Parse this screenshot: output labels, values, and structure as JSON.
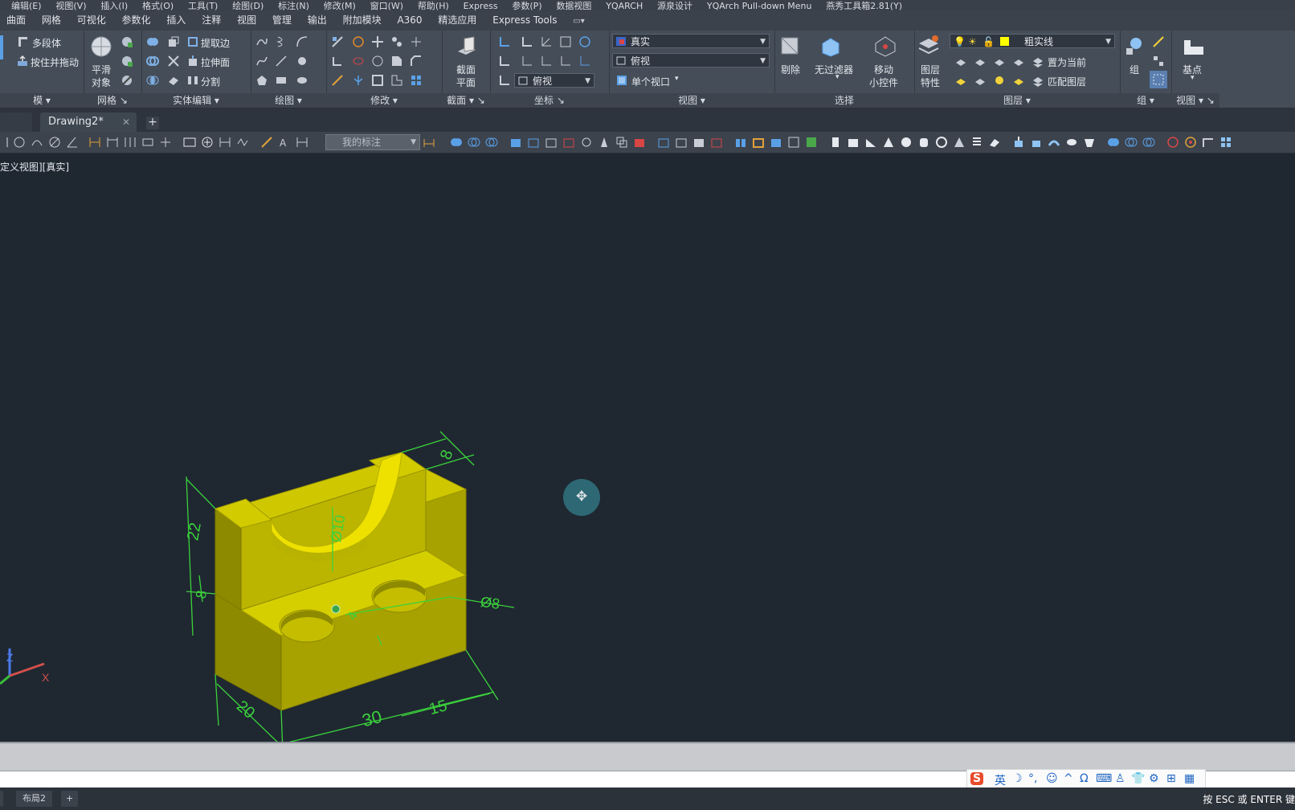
{
  "menu": [
    "编辑(E)",
    "视图(V)",
    "插入(I)",
    "格式(O)",
    "工具(T)",
    "绘图(D)",
    "标注(N)",
    "修改(M)",
    "窗口(W)",
    "帮助(H)",
    "Express",
    "参数(P)",
    "数据视图",
    "YQARCH",
    "源泉设计",
    "YQArch Pull-down Menu",
    "燕秀工具箱2.81(Y)"
  ],
  "ribbon_tabs": [
    "曲面",
    "网格",
    "可视化",
    "参数化",
    "插入",
    "注释",
    "视图",
    "管理",
    "输出",
    "附加模块",
    "A360",
    "精选应用",
    "Express Tools"
  ],
  "ribbon": {
    "modeling": {
      "title": "模",
      "items": [
        "多段体",
        "按住并拖动"
      ]
    },
    "mesh": {
      "title": "网格",
      "smooth_1": "平滑",
      "smooth_2": "对象"
    },
    "solid_edit": {
      "title": "实体编辑",
      "items": [
        "提取边",
        "拉伸面",
        "分割"
      ]
    },
    "draw": {
      "title": "绘图"
    },
    "modify": {
      "title": "修改"
    },
    "section": {
      "title": "截面",
      "plane_1": "截面",
      "plane_2": "平面"
    },
    "coordinates": {
      "title": "坐标",
      "view_combo": "俯视"
    },
    "view": {
      "title": "视图",
      "visual_style": "真实",
      "view_name": "俯视",
      "viewport": "单个视口"
    },
    "selection": {
      "title": "选择",
      "cull": "剔除",
      "no_filter": "无过滤器",
      "move_1": "移动",
      "move_2": "小控件"
    },
    "layers": {
      "title": "图层",
      "props_1": "图层",
      "props_2": "特性",
      "current_layer": "粗实线",
      "set_current": "置为当前",
      "match": "匹配图层",
      "layer_color": "#ffff00"
    },
    "groups": {
      "title": "组",
      "group": "组"
    },
    "view2": {
      "title": "视图",
      "base": "基点"
    }
  },
  "doc_tabs": {
    "active": "Drawing2*",
    "add": "+"
  },
  "toolbar": {
    "dim_style": "我的标注"
  },
  "viewport": {
    "label": "定义视图][真实]",
    "dimensions": [
      "8",
      "22",
      "8",
      "20",
      "30",
      "15",
      "Ø8",
      "Ø10",
      "4"
    ],
    "ucs": {
      "z": "Z",
      "x": "X"
    },
    "model_color": "#c9c000",
    "dimension_color": "#3bd23b"
  },
  "statusbar": {
    "layout_tab": "布局2",
    "add": "+",
    "hint": "按 ESC 或 ENTER 键"
  },
  "ime": [
    "S",
    "英",
    "☽",
    "°,",
    "☺",
    "^",
    "Ω",
    "⌨",
    "♙",
    "👕",
    "⚙",
    "⊞",
    "▦"
  ]
}
